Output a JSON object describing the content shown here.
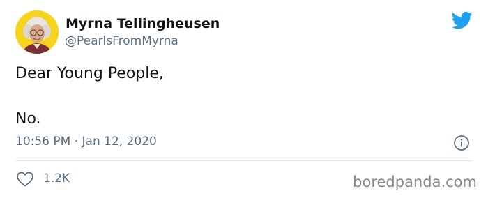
{
  "author": {
    "display_name": "Myrna Tellingheusen",
    "handle": "@PearlsFromMyrna",
    "avatar_icon": "elderly-woman-avatar",
    "avatar_bg": "#f6d31c"
  },
  "tweet": {
    "line1": "Dear Young People,",
    "line2": "No.",
    "timestamp": "10:56 PM · Jan 12, 2020"
  },
  "actions": {
    "like_icon": "heart-outline-icon",
    "like_count": "1.2K",
    "info_icon": "info-circle-icon"
  },
  "brand": {
    "twitter_icon": "twitter-bird-icon",
    "twitter_color": "#1da1f2",
    "watermark": "boredpanda.com"
  }
}
